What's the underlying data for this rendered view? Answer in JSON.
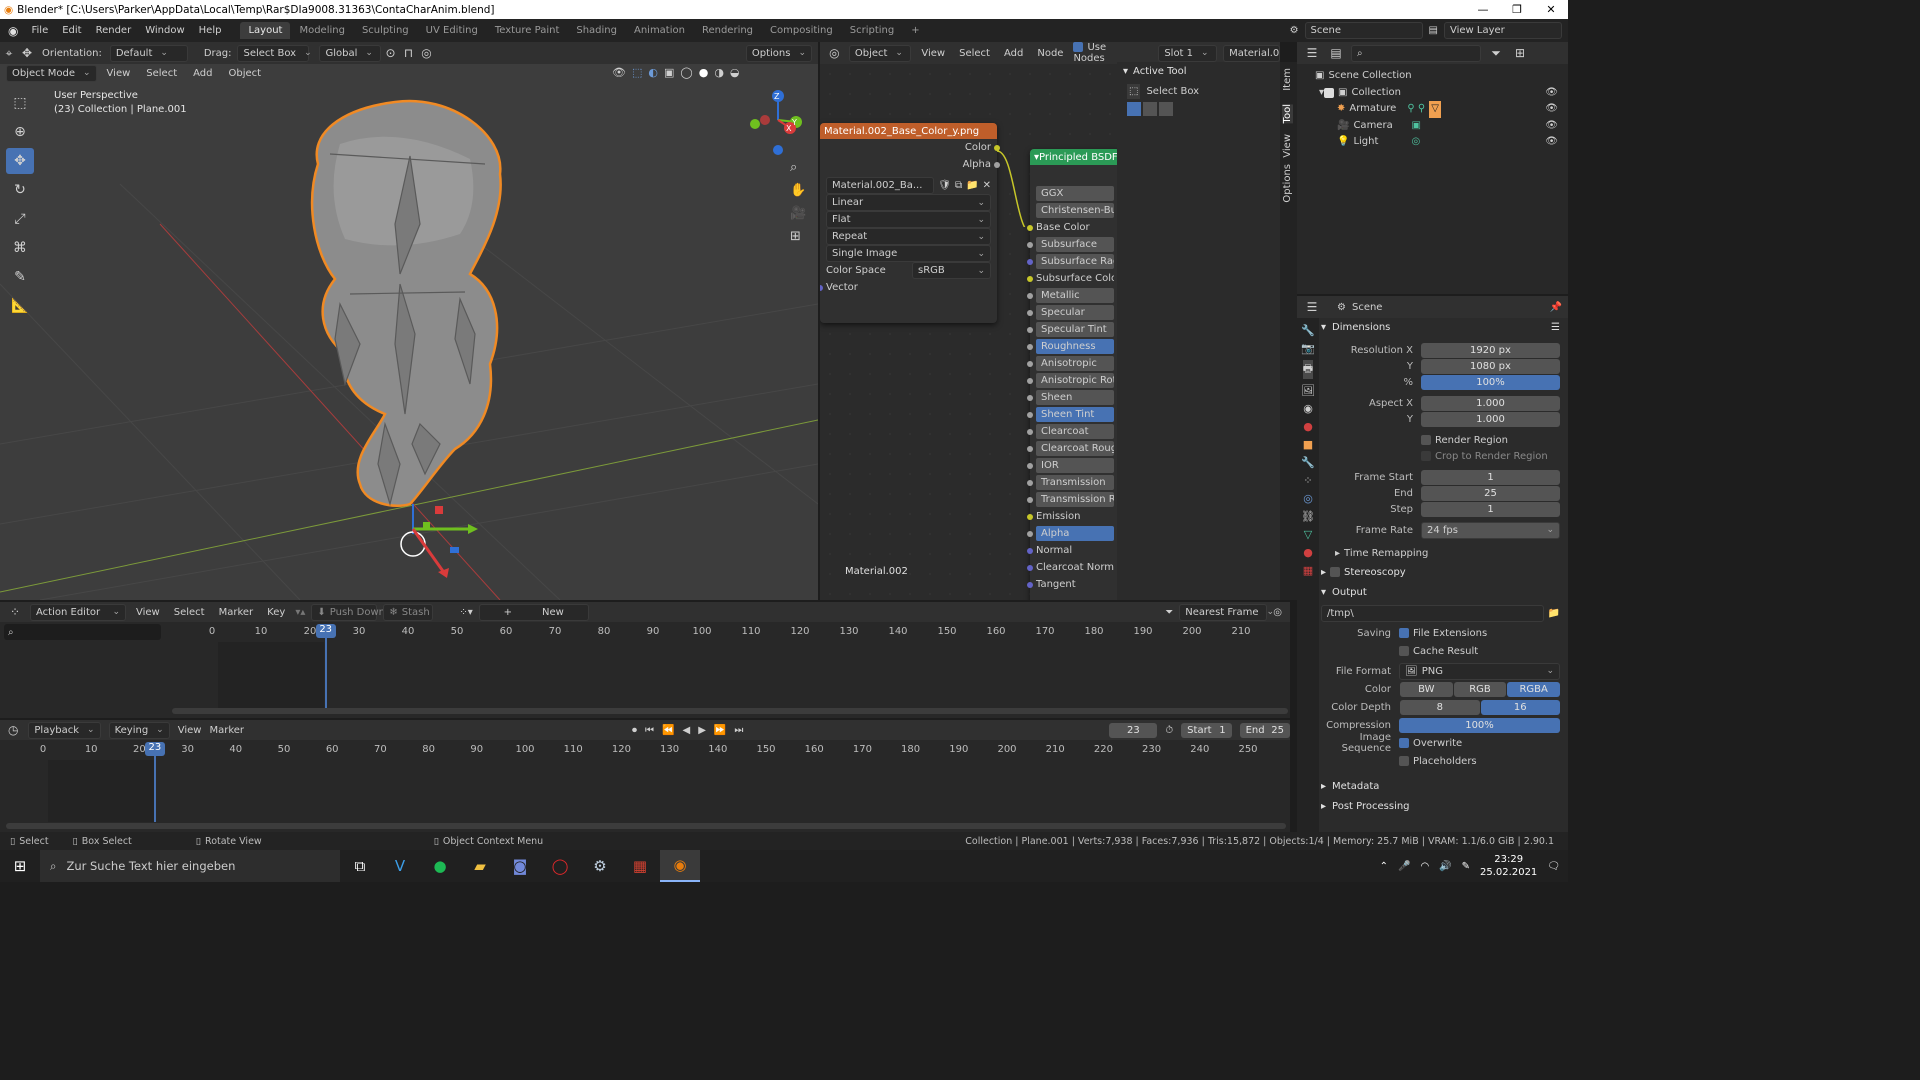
{
  "window": {
    "title": "Blender* [C:\\Users\\Parker\\AppData\\Local\\Temp\\Rar$DIa9008.31363\\ContaCharAnim.blend]",
    "min": "—",
    "max": "❐",
    "close": "✕"
  },
  "menu": [
    "File",
    "Edit",
    "Render",
    "Window",
    "Help"
  ],
  "workspaces": [
    "Layout",
    "Modeling",
    "Sculpting",
    "UV Editing",
    "Texture Paint",
    "Shading",
    "Animation",
    "Rendering",
    "Compositing",
    "Scripting",
    "+"
  ],
  "scene": {
    "label": "Scene",
    "view_layer": "View Layer"
  },
  "vp_header": {
    "orientation_label": "Orientation:",
    "orientation": "Default",
    "drag_label": "Drag:",
    "drag": "Select Box",
    "transform": "Global",
    "options": "Options"
  },
  "vp_header2": {
    "mode": "Object Mode",
    "items": [
      "View",
      "Select",
      "Add",
      "Object"
    ]
  },
  "vp_overlay": {
    "line1": "User Perspective",
    "line2": "(23) Collection | Plane.001"
  },
  "gizmo": {
    "x": "X",
    "y": "Y",
    "z": "Z"
  },
  "node_header": {
    "type": "Object",
    "items": [
      "View",
      "Select",
      "Add",
      "Node"
    ],
    "use_nodes": "Use Nodes",
    "slot": "Slot 1",
    "material": "Material.0"
  },
  "image_node": {
    "title": "Material.002_Base_Color_y.png",
    "out_color": "Color",
    "out_alpha": "Alpha",
    "image": "Material.002_Ba...",
    "interp": "Linear",
    "proj": "Flat",
    "ext": "Repeat",
    "source": "Single Image",
    "cs_label": "Color Space",
    "cs": "sRGB",
    "vector": "Vector"
  },
  "bsdf_node": {
    "title": "Principled BSDF",
    "dist": "GGX",
    "sss": "Christensen-Burle",
    "inputs": [
      {
        "l": "Base Color",
        "c": "#c7c729",
        "f": false,
        "b": false
      },
      {
        "l": "Subsurface",
        "c": "#a1a1a1",
        "f": true,
        "b": false
      },
      {
        "l": "Subsurface Radius",
        "c": "#6363c7",
        "f": true,
        "b": false
      },
      {
        "l": "Subsurface Color",
        "c": "#c7c729",
        "f": false,
        "b": false
      },
      {
        "l": "Metallic",
        "c": "#a1a1a1",
        "f": true,
        "b": false
      },
      {
        "l": "Specular",
        "c": "#a1a1a1",
        "f": true,
        "b": false
      },
      {
        "l": "Specular Tint",
        "c": "#a1a1a1",
        "f": true,
        "b": false
      },
      {
        "l": "Roughness",
        "c": "#a1a1a1",
        "f": true,
        "b": true
      },
      {
        "l": "Anisotropic",
        "c": "#a1a1a1",
        "f": true,
        "b": false
      },
      {
        "l": "Anisotropic Rotat",
        "c": "#a1a1a1",
        "f": true,
        "b": false
      },
      {
        "l": "Sheen",
        "c": "#a1a1a1",
        "f": true,
        "b": false
      },
      {
        "l": "Sheen Tint",
        "c": "#a1a1a1",
        "f": true,
        "b": true
      },
      {
        "l": "Clearcoat",
        "c": "#a1a1a1",
        "f": true,
        "b": false
      },
      {
        "l": "Clearcoat Roughr",
        "c": "#a1a1a1",
        "f": true,
        "b": false
      },
      {
        "l": "IOR",
        "c": "#a1a1a1",
        "f": true,
        "b": false
      },
      {
        "l": "Transmission",
        "c": "#a1a1a1",
        "f": true,
        "b": false
      },
      {
        "l": "Transmission Rou",
        "c": "#a1a1a1",
        "f": true,
        "b": false
      },
      {
        "l": "Emission",
        "c": "#c7c729",
        "f": false,
        "b": false
      },
      {
        "l": "Alpha",
        "c": "#a1a1a1",
        "f": true,
        "b": true
      },
      {
        "l": "Normal",
        "c": "#6363c7",
        "f": false,
        "b": false
      },
      {
        "l": "Clearcoat Normal",
        "c": "#6363c7",
        "f": false,
        "b": false
      },
      {
        "l": "Tangent",
        "c": "#6363c7",
        "f": false,
        "b": false
      }
    ]
  },
  "node_footer": "Material.002",
  "sidebar": {
    "panel": "Active Tool",
    "tool": "Select Box",
    "tabs": [
      "Item",
      "Tool",
      "View",
      "Options"
    ]
  },
  "outliner": {
    "root": "Scene Collection",
    "collection": "Collection",
    "items": [
      "Armature",
      "Camera",
      "Light"
    ]
  },
  "props": {
    "scene": "Scene",
    "dimensions": "Dimensions",
    "res_x_l": "Resolution X",
    "res_x": "1920 px",
    "res_y_l": "Y",
    "res_y": "1080 px",
    "pct_l": "%",
    "pct": "100%",
    "asp_x_l": "Aspect X",
    "asp_x": "1.000",
    "asp_y_l": "Y",
    "asp_y": "1.000",
    "render_region": "Render Region",
    "crop": "Crop to Render Region",
    "fs_l": "Frame Start",
    "fs": "1",
    "fe_l": "End",
    "fe": "25",
    "step_l": "Step",
    "step": "1",
    "fr_l": "Frame Rate",
    "fr": "24 fps",
    "time_remap": "Time Remapping",
    "stereo": "Stereoscopy",
    "output": "Output",
    "path": "/tmp\\",
    "saving": "Saving",
    "file_ext": "File Extensions",
    "cache": "Cache Result",
    "ff_l": "File Format",
    "ff": "PNG",
    "color_l": "Color",
    "bw": "BW",
    "rgb": "RGB",
    "rgba": "RGBA",
    "depth_l": "Color Depth",
    "d8": "8",
    "d16": "16",
    "comp_l": "Compression",
    "comp": "100%",
    "seq_l": "Image Sequence",
    "overwrite": "Overwrite",
    "placeholders": "Placeholders",
    "metadata": "Metadata",
    "post": "Post Processing"
  },
  "action_editor": {
    "mode": "Action Editor",
    "items": [
      "View",
      "Select",
      "Marker",
      "Key"
    ],
    "push": "Push Down",
    "stash": "Stash",
    "new": "New",
    "snap": "Nearest Frame",
    "current": "23",
    "ruler": [
      "0",
      "10",
      "20",
      "30",
      "40",
      "50",
      "60",
      "70",
      "80",
      "90",
      "100",
      "110",
      "120",
      "130",
      "140",
      "150",
      "160",
      "170",
      "180",
      "190",
      "200",
      "210"
    ]
  },
  "timeline": {
    "items": [
      "Playback",
      "Keying",
      "View",
      "Marker"
    ],
    "frame": "23",
    "start_l": "Start",
    "start": "1",
    "end_l": "End",
    "end": "25",
    "current": "23",
    "ruler": [
      "0",
      "10",
      "20",
      "30",
      "40",
      "50",
      "60",
      "70",
      "80",
      "90",
      "100",
      "110",
      "120",
      "130",
      "140",
      "150",
      "160",
      "170",
      "180",
      "190",
      "200",
      "210",
      "220",
      "230",
      "240",
      "250"
    ]
  },
  "status": {
    "select": "Select",
    "box": "Box Select",
    "rotate": "Rotate View",
    "ctx": "Object Context Menu",
    "stats": "Collection | Plane.001 | Verts:7,938 | Faces:7,936 | Tris:15,872 | Objects:1/4 | Memory: 25.7 MiB | VRAM: 1.1/6.0 GiB | 2.90.1"
  },
  "taskbar": {
    "search": "Zur Suche Text hier eingeben",
    "time": "23:29",
    "date": "25.02.2021"
  }
}
